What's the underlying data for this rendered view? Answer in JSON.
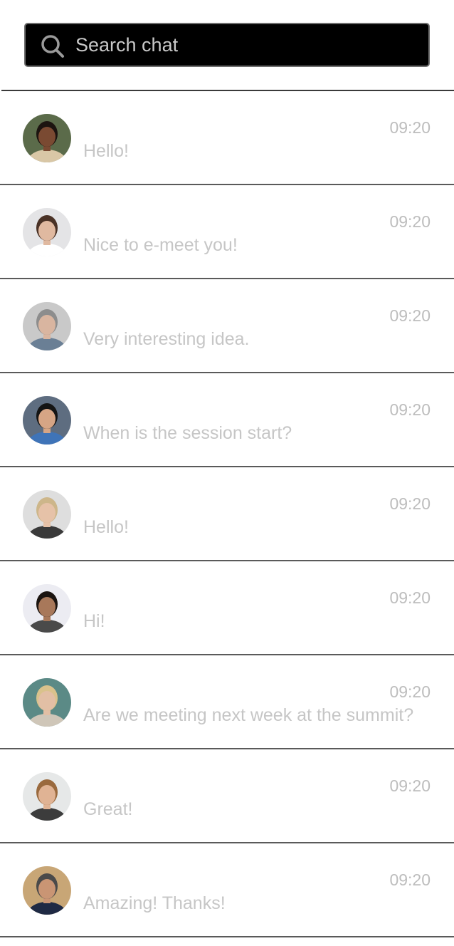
{
  "search": {
    "placeholder": "Search chat",
    "icon": "search-icon"
  },
  "chats": [
    {
      "time": "09:20",
      "message": "Hello!",
      "avatar": {
        "bg": "#5b6b4a",
        "skin": "#7a4a32",
        "hair": "#1c1410",
        "shirt": "#d9c7a6"
      }
    },
    {
      "time": "09:20",
      "message": "Nice to e-meet you!",
      "avatar": {
        "bg": "#e4e4e6",
        "skin": "#e0b9a0",
        "hair": "#4a3226",
        "shirt": "#ffffff"
      }
    },
    {
      "time": "09:20",
      "message": "Very interesting idea.",
      "avatar": {
        "bg": "#c9c9c9",
        "skin": "#d9b5a0",
        "hair": "#8d8d8d",
        "shirt": "#6a7f95"
      }
    },
    {
      "time": "09:20",
      "message": "When is the session start?",
      "avatar": {
        "bg": "#5e6d80",
        "skin": "#d6a585",
        "hair": "#141414",
        "shirt": "#3f74b8"
      }
    },
    {
      "time": "09:20",
      "message": "Hello!",
      "avatar": {
        "bg": "#dedede",
        "skin": "#e6c2a8",
        "hair": "#cdb68a",
        "shirt": "#3a3a3a"
      }
    },
    {
      "time": "09:20",
      "message": "Hi!",
      "avatar": {
        "bg": "#ececf2",
        "skin": "#a8785a",
        "hair": "#1b1410",
        "shirt": "#4a4a4a"
      }
    },
    {
      "time": "09:20",
      "message": "Are we meeting next week at the summit?",
      "avatar": {
        "bg": "#5b8a86",
        "skin": "#e2bfa5",
        "hair": "#d9c28c",
        "shirt": "#cfc6b8"
      }
    },
    {
      "time": "09:20",
      "message": "Great!",
      "avatar": {
        "bg": "#e6e8e8",
        "skin": "#e0b394",
        "hair": "#9a6a3e",
        "shirt": "#3c3c3c"
      }
    },
    {
      "time": "09:20",
      "message": "Amazing! Thanks!",
      "avatar": {
        "bg": "#c8a676",
        "skin": "#c99574",
        "hair": "#4a4a4a",
        "shirt": "#1f2a44"
      }
    }
  ]
}
